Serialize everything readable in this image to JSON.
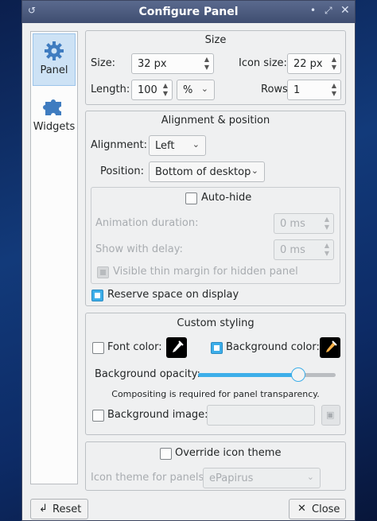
{
  "window": {
    "title": "Configure Panel"
  },
  "sidebar": {
    "items": [
      {
        "label": "Panel",
        "icon": "gear-icon"
      },
      {
        "label": "Widgets",
        "icon": "puzzle-icon"
      }
    ]
  },
  "size": {
    "title": "Size",
    "size_label": "Size:",
    "size_value": "32 px",
    "icon_size_label": "Icon size:",
    "icon_size_value": "22 px",
    "length_label": "Length:",
    "length_value": "100",
    "length_unit": "%",
    "rows_label": "Rows:",
    "rows_value": "1"
  },
  "alignment": {
    "title": "Alignment & position",
    "alignment_label": "Alignment:",
    "alignment_value": "Left",
    "position_label": "Position:",
    "position_value": "Bottom of desktop",
    "autohide_label": "Auto-hide",
    "anim_label": "Animation duration:",
    "anim_value": "0 ms",
    "delay_label": "Show with delay:",
    "delay_value": "0 ms",
    "thin_margin_label": "Visible thin margin for hidden panel",
    "reserve_label": "Reserve space on display"
  },
  "styling": {
    "title": "Custom styling",
    "font_color_label": "Font color:",
    "bg_color_label": "Background color:",
    "opacity_label": "Background opacity:",
    "opacity_value": 0.73,
    "compositing_note": "Compositing is required for panel transparency.",
    "bg_image_label": "Background image:"
  },
  "theme": {
    "override_label": "Override icon theme",
    "icon_theme_label": "Icon theme for panels:",
    "icon_theme_value": "ePapirus"
  },
  "buttons": {
    "reset": "Reset",
    "close": "Close"
  },
  "colors": {
    "accent": "#3daee9",
    "titlebar": "#46557a"
  }
}
